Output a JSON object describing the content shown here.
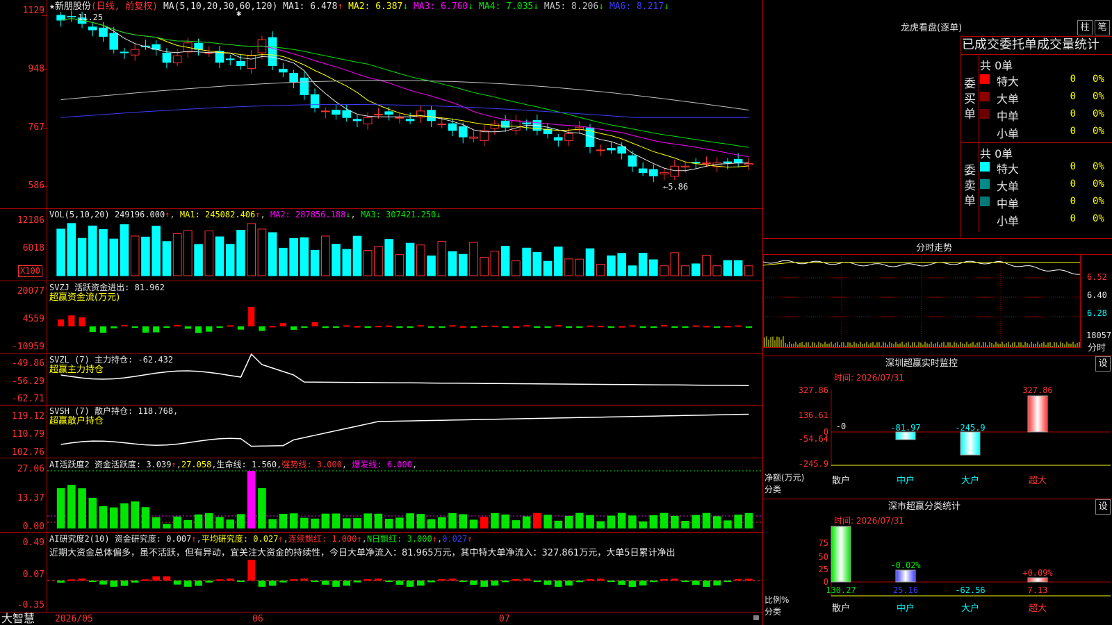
{
  "app": {
    "brand": "大智慧"
  },
  "main": {
    "stock_title": "★新朋股份",
    "mode": "(日线, 前复权)",
    "ma_label": "MA(5,10,20,30,60,120)",
    "ma": [
      {
        "label": "MA1:",
        "value": "6.478",
        "arrow": "↑",
        "color": "#e6e6e6"
      },
      {
        "label": "MA2:",
        "value": "6.387",
        "arrow": "↓",
        "color": "#ffff00"
      },
      {
        "label": "MA3:",
        "value": "6.760",
        "arrow": "↓",
        "color": "#ff00ff"
      },
      {
        "label": "MA4:",
        "value": "7.035",
        "arrow": "↓",
        "color": "#00e600"
      },
      {
        "label": "MA5:",
        "value": "8.206",
        "arrow": "↓",
        "color": "#c0c0c0"
      },
      {
        "label": "MA6:",
        "value": "8.217",
        "arrow": "↓",
        "color": "#3c3cff"
      }
    ],
    "y_ticks": [
      "1129",
      "948",
      "767",
      "586"
    ],
    "high_label": "11.25",
    "low_label": "←5.86",
    "star": "✱"
  },
  "vol": {
    "label": "VOL(5,10,20)",
    "value": "249196.000",
    "ma1": "MA1: 245082.406",
    "ma2": "MA2: 287856.188",
    "ma3": "MA3: 307421.250",
    "y_ticks": [
      "12186",
      "6018"
    ],
    "unit": "X100"
  },
  "svzj": {
    "label": "SVZJ  活跃资金进出: 81.962",
    "sub": "超赢资金流(万元)",
    "y_ticks": [
      "20077",
      "4559",
      "-10959"
    ]
  },
  "svzl": {
    "label": "SVZL (7) 主力持仓: -62.432",
    "sub": "超赢主力持仓",
    "y_ticks": [
      "-49.86",
      "-56.29",
      "-62.71"
    ]
  },
  "svsh": {
    "label": "SVSH (7) 散户持仓: 118.768,",
    "sub": "超赢散户持仓",
    "y_ticks": [
      "119.12",
      "110.79",
      "102.76"
    ]
  },
  "ai1": {
    "label": "AI活跃度2 资金活跃度: 3.039",
    "v2": "27.058",
    "life": "生命线: 1.560",
    "strong": "强势线: 3.000",
    "burst": "爆发线: 6.000",
    "y_ticks": [
      "27.06",
      "13.37",
      "0.00"
    ]
  },
  "ai2": {
    "label": "AI研究度2(10) 资金研究度: 0.007",
    "avg": "平均研究度: 0.027",
    "cont": "连续飘红: 1.000",
    "nday": "N日飘红: 3.000",
    "last": "0.027",
    "y_ticks": [
      "0.49",
      "0.07",
      "-0.35"
    ],
    "commentary": "近期大资金总体偏多，虽不活跃，但有异动，宜关注大资金的持续性，今日大单净流入：81.965万元，其中特大单净流入：327.861万元，大单5日累计净出"
  },
  "xaxis": {
    "labels": [
      "2026/05",
      "06",
      "07"
    ]
  },
  "lhb": {
    "title": "龙虎看盘(逐单)",
    "btn1": "柱",
    "btn2": "笔",
    "header": "已成交委托单成交量统计",
    "buy_label": "委买单",
    "sell_label": "委卖单",
    "buy_total": "共 0单",
    "sell_total": "共 0单",
    "buy_rows": [
      {
        "name": "特大",
        "count": "0",
        "pct": "0%",
        "color": "#ff0000"
      },
      {
        "name": "大单",
        "count": "0",
        "pct": "0%",
        "color": "#8b0000"
      },
      {
        "name": "中单",
        "count": "0",
        "pct": "0%",
        "color": "#6b0000"
      },
      {
        "name": "小单",
        "count": "0",
        "pct": "0%",
        "color": "#000000"
      }
    ],
    "sell_rows": [
      {
        "name": "特大",
        "count": "0",
        "pct": "0%",
        "color": "#00ffff"
      },
      {
        "name": "大单",
        "count": "0",
        "pct": "0%",
        "color": "#008b8b"
      },
      {
        "name": "中单",
        "count": "0",
        "pct": "0%",
        "color": "#007878"
      },
      {
        "name": "小单",
        "count": "0",
        "pct": "0%",
        "color": "#000000"
      }
    ]
  },
  "intraday": {
    "title": "分时走势",
    "y_ticks": [
      "6.52",
      "6.40",
      "6.28"
    ],
    "vol_label": "18057",
    "vol_unit": "分时"
  },
  "sz_monitor": {
    "title": "深圳超赢实时监控",
    "btn": "设",
    "time": "时间: 2026/07/31",
    "y_ticks": [
      "327.86",
      "136.61",
      "0",
      "-54.64",
      "-245.9"
    ],
    "net_label": "净额(万元)",
    "cat_label": "分类",
    "categories": [
      "散户",
      "中户",
      "大户",
      "超大"
    ],
    "values": [
      "-0",
      "-81.97",
      "-245.9",
      "327.86"
    ]
  },
  "sz_class": {
    "title": "深市超赢分类统计",
    "btn": "设",
    "time": "时间: 2026/07/31",
    "y_ticks": [
      "75",
      "50",
      "25",
      "0"
    ],
    "ratio_label": "比例%",
    "cat_label": "分类",
    "categories": [
      "散户",
      "中户",
      "大户",
      "超大"
    ],
    "values": [
      "130.27",
      "25.16",
      "-62.56",
      "7.13"
    ],
    "pct_labels": [
      "",
      "-0.02%",
      "",
      "+0.09%"
    ]
  },
  "chart_data": [
    {
      "type": "candlestick",
      "title": "新朋股份 (日线, 前复权)",
      "ylim": [
        5.86,
        11.25
      ],
      "y_tick_labels": [
        "1129",
        "948",
        "767",
        "586"
      ],
      "ohlc_approx_close": [
        10.9,
        11.0,
        10.8,
        10.6,
        10.4,
        10.0,
        9.9,
        10.0,
        10.1,
        10.0,
        9.6,
        9.8,
        10.2,
        10.0,
        9.9,
        9.6,
        9.7,
        9.5,
        9.8,
        10.3,
        9.5,
        9.3,
        9.0,
        8.6,
        8.2,
        8.1,
        8.0,
        7.9,
        7.8,
        7.9,
        8.0,
        8.0,
        7.9,
        7.8,
        8.1,
        7.8,
        7.7,
        7.5,
        7.3,
        7.3,
        7.5,
        7.7,
        7.6,
        7.8,
        7.7,
        7.5,
        7.4,
        7.2,
        7.4,
        7.6,
        7.0,
        6.9,
        6.9,
        6.8,
        6.4,
        6.2,
        6.1,
        6.2,
        6.4,
        6.4,
        6.5,
        6.5,
        6.5,
        6.5,
        6.5,
        6.48
      ],
      "high": 11.25,
      "low": 5.86,
      "ma": {
        "MA1": 6.478,
        "MA2": 6.387,
        "MA3": 6.76,
        "MA4": 7.035,
        "MA5": 8.206,
        "MA6": 8.217
      }
    },
    {
      "type": "bar",
      "title": "深圳超赢实时监控",
      "categories": [
        "散户",
        "中户",
        "大户",
        "超大"
      ],
      "values": [
        0,
        -81.97,
        -245.9,
        327.86
      ],
      "ylabel": "净额(万元)"
    },
    {
      "type": "bar",
      "title": "深市超赢分类统计",
      "categories": [
        "散户",
        "中户",
        "大户",
        "超大"
      ],
      "values": [
        130.27,
        25.16,
        -62.56,
        7.13
      ],
      "ylabel": "比例%"
    }
  ]
}
